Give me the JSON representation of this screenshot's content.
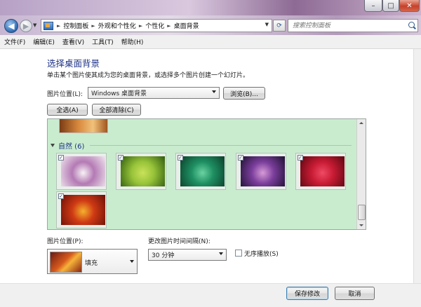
{
  "window": {
    "minimize_symbol": "–",
    "maximize_symbol": "□",
    "close_symbol": "✕"
  },
  "nav": {
    "back_symbol": "◀",
    "forward_symbol": "▶",
    "breadcrumbs": [
      "控制面板",
      "外观和个性化",
      "个性化",
      "桌面背景"
    ],
    "search_placeholder": "搜索控制面板"
  },
  "menu": {
    "items": [
      "文件(F)",
      "编辑(E)",
      "查看(V)",
      "工具(T)",
      "帮助(H)"
    ]
  },
  "main": {
    "heading": "选择桌面背景",
    "instruction": "单击某个图片使其成为您的桌面背景，或选择多个图片创建一个幻灯片。",
    "location_label": "图片位置(L):",
    "location_value": "Windows 桌面背景",
    "browse_label": "浏览(B)...",
    "select_all_label": "全选(A)",
    "clear_all_label": "全部清除(C)"
  },
  "picture_group": {
    "title": "自然 (6)",
    "thumbnails": [
      {
        "name": "thumb-white-flower",
        "checked": true,
        "colors": [
          "#efe7ee",
          "#b47ab4",
          "#f8f2f6"
        ]
      },
      {
        "name": "thumb-green-leaves",
        "checked": true,
        "colors": [
          "#2f5b0e",
          "#98c43a",
          "#c9e15a"
        ]
      },
      {
        "name": "thumb-green-plant",
        "checked": true,
        "colors": [
          "#0b3f2a",
          "#1e8f62",
          "#6bd3a2"
        ]
      },
      {
        "name": "thumb-purple-thistle",
        "checked": true,
        "colors": [
          "#1c1130",
          "#7b3e9c",
          "#d79bd7"
        ]
      },
      {
        "name": "thumb-red-dahlia",
        "checked": true,
        "colors": [
          "#5a0710",
          "#c81b34",
          "#f04a64"
        ]
      },
      {
        "name": "thumb-autumn-leaves",
        "checked": true,
        "colors": [
          "#6a0f08",
          "#cf3a14",
          "#f5b12e"
        ]
      }
    ]
  },
  "bottom": {
    "position_label": "图片位置(P):",
    "position_value": "填充",
    "interval_label": "更改图片时间间隔(N):",
    "interval_value": "30 分钟",
    "shuffle_label": "无序播放(S)",
    "shuffle_checked": false
  },
  "footer": {
    "save_label": "保存修改",
    "cancel_label": "取消"
  },
  "colors": {
    "heading": "#1e3287",
    "list_background": "#c9eccf"
  }
}
